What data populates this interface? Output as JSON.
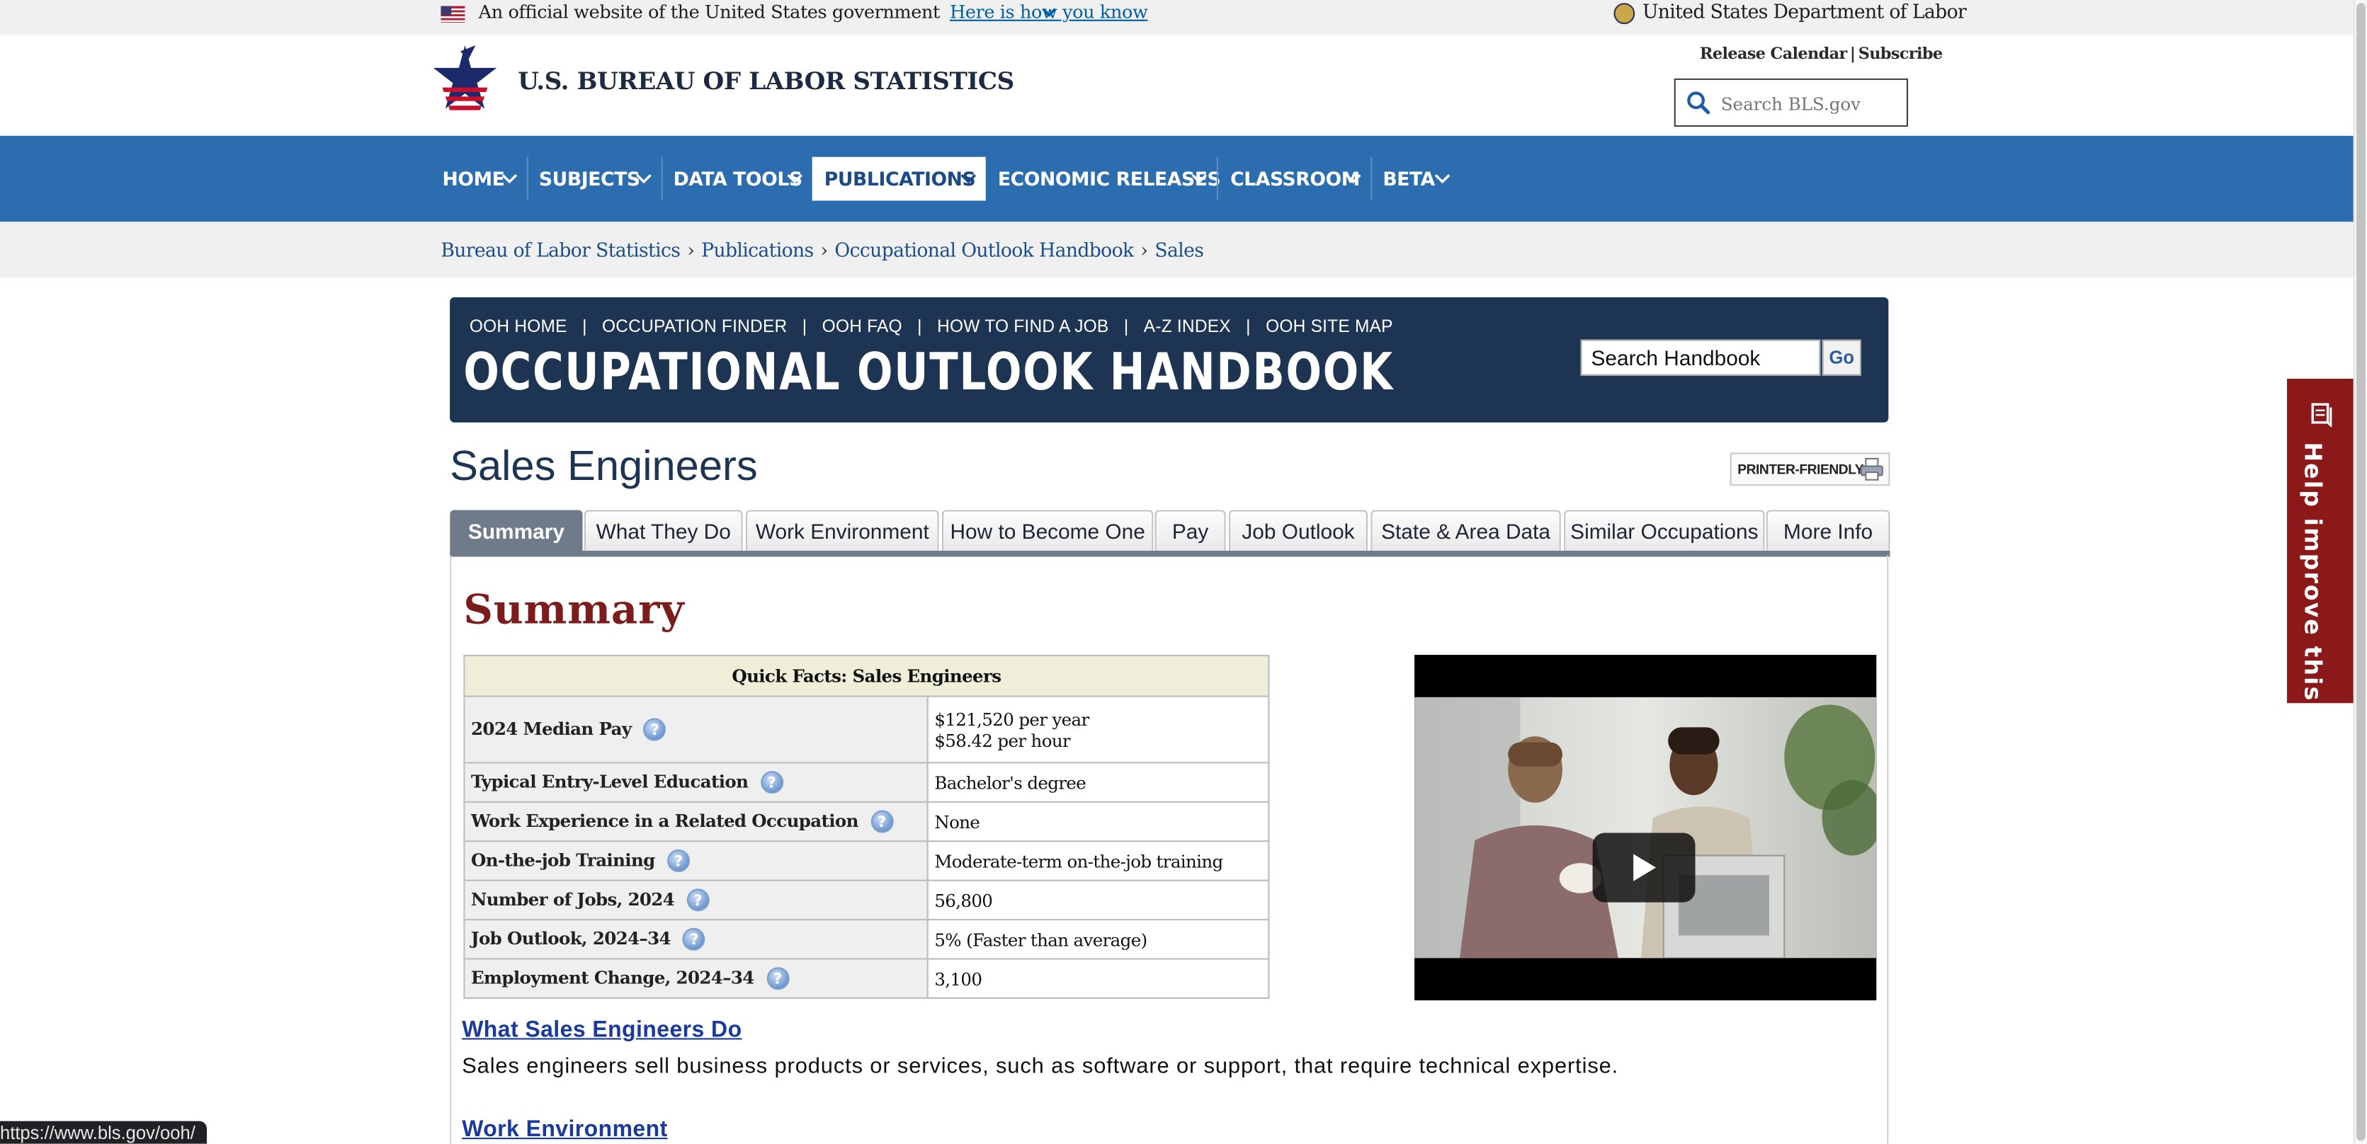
{
  "gov_banner": {
    "official_text": "An official website of the United States government",
    "how_link": "Here is how you know",
    "department": "United States Department of Labor"
  },
  "header": {
    "site_title": "U.S. BUREAU OF LABOR STATISTICS",
    "release_calendar": "Release Calendar",
    "separator": "|",
    "subscribe": "Subscribe",
    "search_placeholder": "Search BLS.gov"
  },
  "nav": {
    "items": [
      {
        "label": "HOME"
      },
      {
        "label": "SUBJECTS"
      },
      {
        "label": "DATA TOOLS"
      },
      {
        "label": "PUBLICATIONS",
        "active": true
      },
      {
        "label": "ECONOMIC RELEASES"
      },
      {
        "label": "CLASSROOM"
      },
      {
        "label": "BETA"
      }
    ]
  },
  "breadcrumb": [
    "Bureau of Labor Statistics",
    "Publications",
    "Occupational Outlook Handbook",
    "Sales"
  ],
  "ooh": {
    "links": [
      "OOH HOME",
      "OCCUPATION FINDER",
      "OOH FAQ",
      "HOW TO FIND A JOB",
      "A-Z INDEX",
      "OOH SITE MAP"
    ],
    "title": "OCCUPATIONAL OUTLOOK HANDBOOK",
    "search_value": "Search Handbook",
    "go": "Go"
  },
  "page": {
    "title": "Sales Engineers",
    "printer_friendly": "PRINTER-FRIENDLY"
  },
  "tabs": [
    "Summary",
    "What They Do",
    "Work Environment",
    "How to Become One",
    "Pay",
    "Job Outlook",
    "State & Area Data",
    "Similar Occupations",
    "More Info"
  ],
  "summary": {
    "heading": "Summary",
    "quick_facts": {
      "title": "Quick Facts: Sales Engineers",
      "rows": [
        {
          "label": "2024 Median Pay",
          "value": "$121,520 per year",
          "value2": "$58.42 per hour"
        },
        {
          "label": "Typical Entry-Level Education",
          "value": "Bachelor's degree"
        },
        {
          "label": "Work Experience in a Related Occupation",
          "value": "None"
        },
        {
          "label": "On-the-job Training",
          "value": "Moderate-term on-the-job training"
        },
        {
          "label": "Number of Jobs, 2024",
          "value": "56,800"
        },
        {
          "label": "Job Outlook, 2024–34",
          "value": "5% (Faster than average)"
        },
        {
          "label": "Employment Change, 2024–34",
          "value": "3,100"
        }
      ]
    },
    "what_link": "What Sales Engineers Do",
    "what_text": "Sales engineers sell business products or services, such as software or support, that require technical expertise.",
    "env_link": "Work Environment"
  },
  "feedback": {
    "label": "Help improve this site"
  },
  "status_url": "https://www.bls.gov/ooh/",
  "qmark": "?"
}
